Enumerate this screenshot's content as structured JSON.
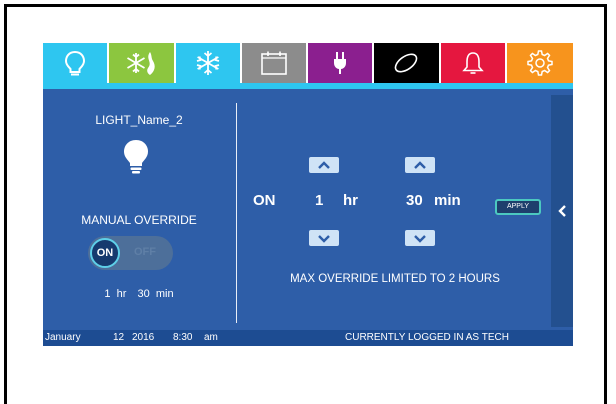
{
  "tabs": [
    {
      "icon": "lightbulb-icon",
      "color": "#2ec6f0"
    },
    {
      "icon": "heat-cool-icon",
      "color": "#8cc63f"
    },
    {
      "icon": "snowflake-icon",
      "color": "#2ec6f0"
    },
    {
      "icon": "calendar-icon",
      "color": "#8c8c8c"
    },
    {
      "icon": "plug-icon",
      "color": "#8b1f8f"
    },
    {
      "icon": "zone-icon",
      "color": "#000000"
    },
    {
      "icon": "bell-icon",
      "color": "#e5173f"
    },
    {
      "icon": "gear-icon",
      "color": "#f7941d"
    }
  ],
  "left": {
    "device_name": "LIGHT_Name_2",
    "mode_label": "MANUAL OVERRIDE",
    "toggle_on": "ON",
    "toggle_off": "OFF",
    "duration_hr_value": "1",
    "duration_hr_unit": "hr",
    "duration_min_value": "30",
    "duration_min_unit": "min"
  },
  "right": {
    "state": "ON",
    "hr_value": "1",
    "hr_unit": "hr",
    "min_value": "30",
    "min_unit": "min",
    "apply_label": "APPLY",
    "note": "MAX OVERRIDE LIMITED TO 2 HOURS"
  },
  "status": {
    "month": "January",
    "day": "12",
    "year": "2016",
    "time": "8:30",
    "ampm": "am",
    "login_text": "CURRENTLY LOGGED IN AS TECH"
  },
  "colors": {
    "panel": "#2e5ea8",
    "accent": "#2ec6f0",
    "status_bar": "#1d4c92"
  }
}
